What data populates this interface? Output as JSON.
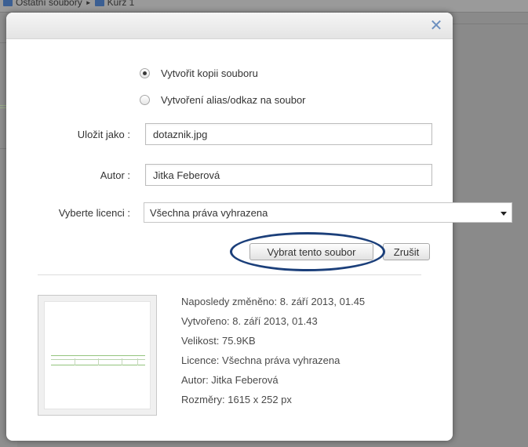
{
  "background": {
    "breadcrumb_items": [
      "Ostatní soubory",
      "Kurz 1"
    ]
  },
  "dialog": {
    "close_icon": "close-x-icon",
    "accent_color": "#6d90bf",
    "highlight_color": "#1b3f7a",
    "radio_options": [
      {
        "label": "Vytvořit kopii souboru",
        "checked": true
      },
      {
        "label": "Vytvoření alias/odkaz na soubor",
        "checked": false
      }
    ],
    "save_as": {
      "label": "Uložit jako :",
      "value": "dotaznik.jpg"
    },
    "author": {
      "label": "Autor :",
      "value": "Jitka Feberová"
    },
    "license": {
      "label": "Vyberte licenci :",
      "selected": "Všechna práva vyhrazena"
    },
    "buttons": {
      "select": "Vybrat tento soubor",
      "cancel": "Zrušit"
    },
    "file_info": {
      "modified": "Naposledy změněno: 8. září 2013, 01.45",
      "created": "Vytvořeno: 8. září 2013, 01.43",
      "size": "Velikost: 75.9KB",
      "license": "Licence: Všechna práva vyhrazena",
      "author": "Autor: Jitka Feberová",
      "dimensions": "Rozměry: 1615 x 252 px"
    }
  }
}
